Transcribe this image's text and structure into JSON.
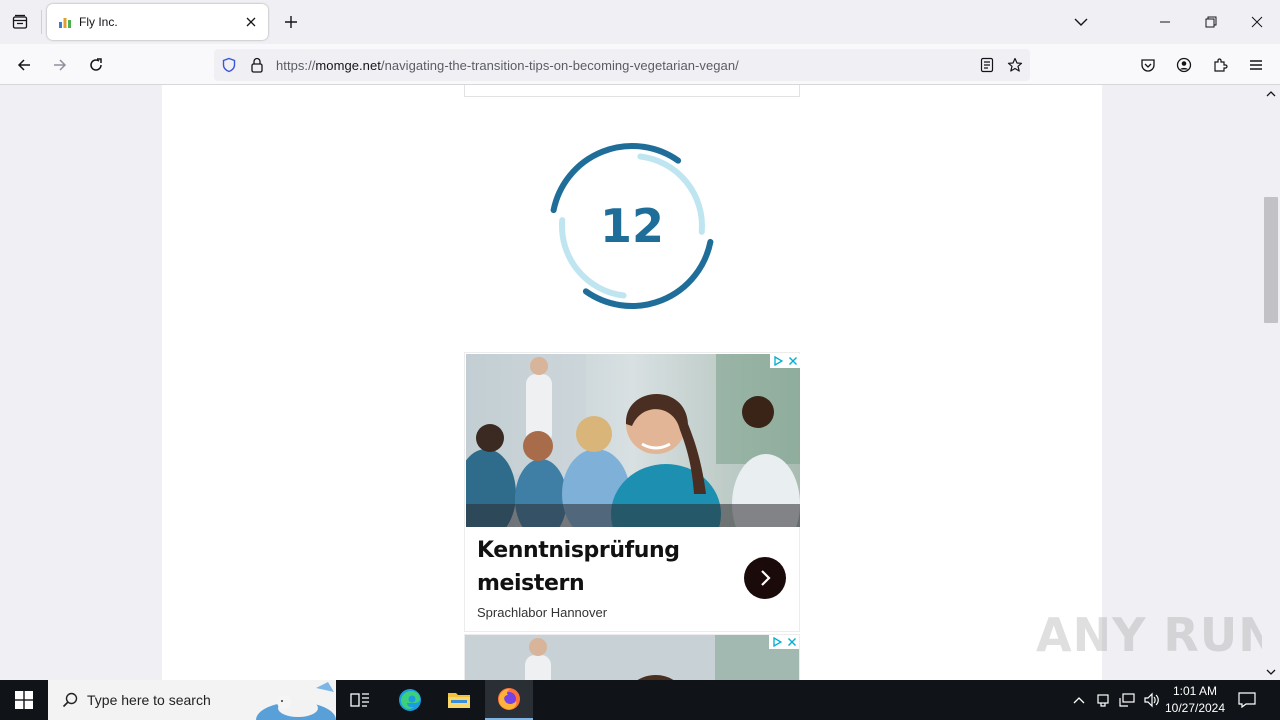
{
  "browser": {
    "tab": {
      "title": "Fly Inc."
    },
    "url": {
      "prefix": "https://",
      "host": "momge.net",
      "path": "/navigating-the-transition-tips-on-becoming-vegetarian-vegan/"
    }
  },
  "page": {
    "countdown": {
      "value": "12",
      "progress": 0.6
    },
    "ad": {
      "title": "Kenntnisprüfung meistern",
      "source": "Sprachlabor Hannover"
    },
    "watermark": "ANY RUN"
  },
  "taskbar": {
    "search_placeholder": "Type here to search",
    "time": "1:01 AM",
    "date": "10/27/2024"
  },
  "colors": {
    "countdown_dark": "#1f6e99",
    "countdown_light": "#bfe6f0",
    "ad_cta": "#1b0a0a"
  }
}
